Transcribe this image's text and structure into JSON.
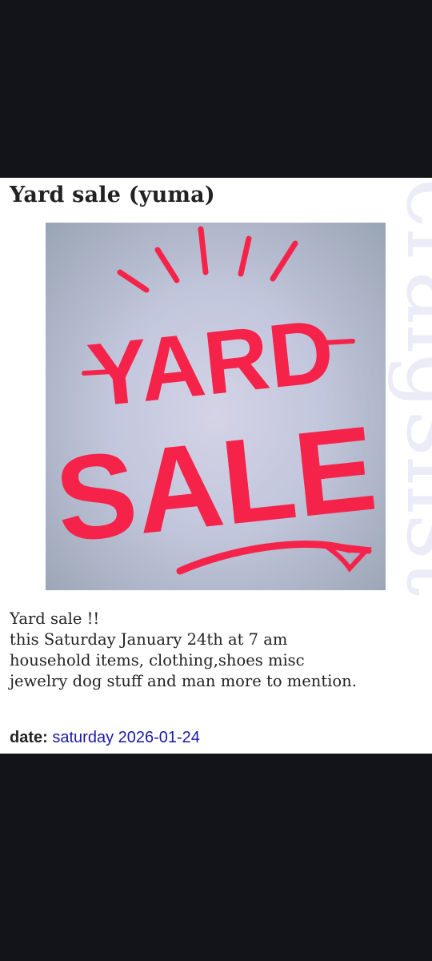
{
  "post": {
    "title": "Yard sale (yuma)",
    "image_text": {
      "line1": "YARD",
      "line2": "SALE"
    },
    "body_lines": [
      "Yard sale !!",
      "this Saturday January 24th at 7 am",
      "household items, clothing,shoes misc",
      "jewelry dog stuff and man more to mention."
    ],
    "date_label": "date:",
    "date_value": "saturday 2026-01-24"
  },
  "watermark": {
    "text": "craigslist"
  },
  "colors": {
    "screen_bg": "#131419",
    "page_bg": "#ffffff",
    "sign_red": "#f5234a",
    "link_blue": "#1a1aa6",
    "watermark": "#ecebf8"
  }
}
